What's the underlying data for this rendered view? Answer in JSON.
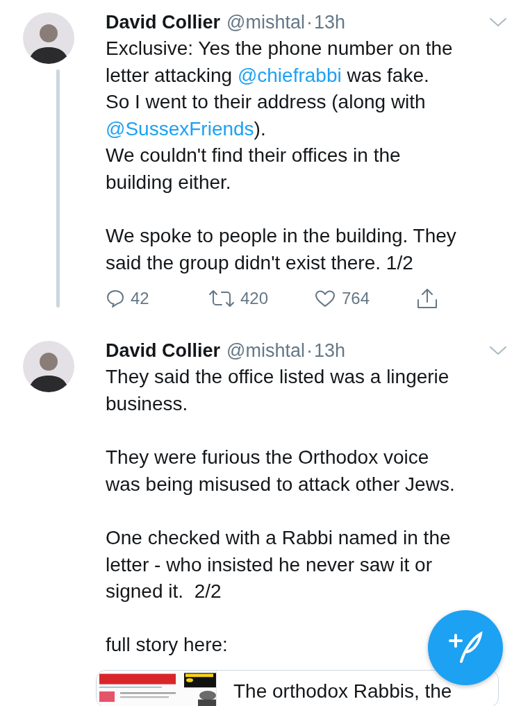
{
  "tweets": [
    {
      "author": "David Collier",
      "handle": "@mishtal",
      "separator": "·",
      "time": "13h",
      "has_thread_line": true,
      "paragraphs": [
        [
          [
            {
              "kind": "text",
              "text": "Exclusive: Yes the phone number on the"
            }
          ],
          [
            {
              "kind": "text",
              "text": "letter attacking "
            },
            {
              "kind": "mention",
              "text": "@chiefrabbi"
            },
            {
              "kind": "text",
              "text": " was fake."
            }
          ],
          [
            {
              "kind": "text",
              "text": "So I went to their address (along with"
            }
          ],
          [
            {
              "kind": "mention",
              "text": "@SussexFriends"
            },
            {
              "kind": "text",
              "text": ")."
            }
          ],
          [
            {
              "kind": "text",
              "text": "We couldn't find their offices in the"
            }
          ],
          [
            {
              "kind": "text",
              "text": "building either."
            }
          ]
        ],
        [
          [
            {
              "kind": "text",
              "text": "We spoke to people in the building. They"
            }
          ],
          [
            {
              "kind": "text",
              "text": "said the group didn't exist there. 1/2"
            }
          ]
        ]
      ],
      "actions": [
        {
          "kind": "reply",
          "count": "42"
        },
        {
          "kind": "retweet",
          "count": "420"
        },
        {
          "kind": "like",
          "count": "764"
        },
        {
          "kind": "share"
        }
      ]
    },
    {
      "author": "David Collier",
      "handle": "@mishtal",
      "separator": "·",
      "time": "13h",
      "has_thread_line": false,
      "paragraphs": [
        [
          [
            {
              "kind": "text",
              "text": "They said the office listed was a lingerie"
            }
          ],
          [
            {
              "kind": "text",
              "text": "business."
            }
          ]
        ],
        [
          [
            {
              "kind": "text",
              "text": "They were furious the Orthodox voice"
            }
          ],
          [
            {
              "kind": "text",
              "text": "was being misused to attack other Jews."
            }
          ]
        ],
        [
          [
            {
              "kind": "text",
              "text": "One checked with a Rabbi named in the"
            }
          ],
          [
            {
              "kind": "text",
              "text": "letter - who insisted he never saw it or"
            }
          ],
          [
            {
              "kind": "text",
              "text": "signed it.  2/2"
            }
          ]
        ],
        [
          [
            {
              "kind": "text",
              "text": "full story here:"
            }
          ]
        ]
      ],
      "link_card": {
        "title": "The orthodox Rabbis, the"
      }
    }
  ]
}
